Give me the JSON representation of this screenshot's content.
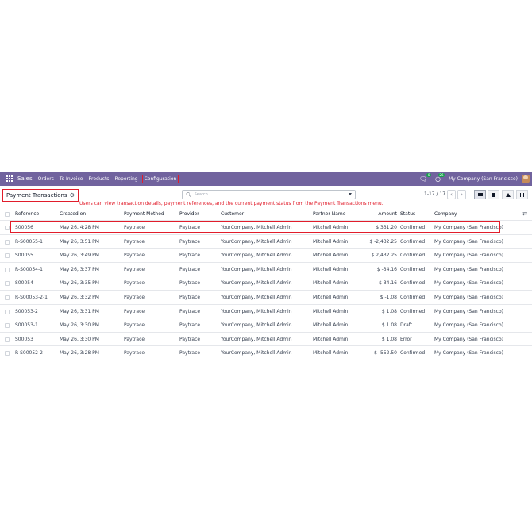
{
  "navbar": {
    "app_name": "Sales",
    "menu": [
      "Orders",
      "To Invoice",
      "Products",
      "Reporting",
      "Configuration"
    ],
    "active_menu": "Configuration",
    "messages_count": "8",
    "activities_count": "26",
    "company": "My Company (San Francisco)"
  },
  "control_panel": {
    "title": "Payment Transactions",
    "annotation": "Users can view transaction details, payment references, and the current payment status from the Payment Transactions menu.",
    "search_placeholder": "Search...",
    "pager": "1-17 / 17"
  },
  "table": {
    "columns": {
      "reference": "Reference",
      "created_on": "Created on",
      "payment_method": "Payment Method",
      "provider": "Provider",
      "customer": "Customer",
      "partner_name": "Partner Name",
      "amount": "Amount",
      "status": "Status",
      "company": "Company"
    },
    "rows": [
      {
        "reference": "S00056",
        "created_on": "May 26, 4:28 PM",
        "payment_method": "Paytrace",
        "provider": "Paytrace",
        "customer": "YourCompany, Mitchell Admin",
        "partner_name": "Mitchell Admin",
        "amount": "$ 331.20",
        "status": "Confirmed",
        "company": "My Company (San Francisco)"
      },
      {
        "reference": "R-S00055-1",
        "created_on": "May 26, 3:51 PM",
        "payment_method": "Paytrace",
        "provider": "Paytrace",
        "customer": "YourCompany, Mitchell Admin",
        "partner_name": "Mitchell Admin",
        "amount": "$ -2,432.25",
        "status": "Confirmed",
        "company": "My Company (San Francisco)"
      },
      {
        "reference": "S00055",
        "created_on": "May 26, 3:49 PM",
        "payment_method": "Paytrace",
        "provider": "Paytrace",
        "customer": "YourCompany, Mitchell Admin",
        "partner_name": "Mitchell Admin",
        "amount": "$ 2,432.25",
        "status": "Confirmed",
        "company": "My Company (San Francisco)"
      },
      {
        "reference": "R-S00054-1",
        "created_on": "May 26, 3:37 PM",
        "payment_method": "Paytrace",
        "provider": "Paytrace",
        "customer": "YourCompany, Mitchell Admin",
        "partner_name": "Mitchell Admin",
        "amount": "$ -34.16",
        "status": "Confirmed",
        "company": "My Company (San Francisco)"
      },
      {
        "reference": "S00054",
        "created_on": "May 26, 3:35 PM",
        "payment_method": "Paytrace",
        "provider": "Paytrace",
        "customer": "YourCompany, Mitchell Admin",
        "partner_name": "Mitchell Admin",
        "amount": "$ 34.16",
        "status": "Confirmed",
        "company": "My Company (San Francisco)"
      },
      {
        "reference": "R-S00053-2-1",
        "created_on": "May 26, 3:32 PM",
        "payment_method": "Paytrace",
        "provider": "Paytrace",
        "customer": "YourCompany, Mitchell Admin",
        "partner_name": "Mitchell Admin",
        "amount": "$ -1.08",
        "status": "Confirmed",
        "company": "My Company (San Francisco)"
      },
      {
        "reference": "S00053-2",
        "created_on": "May 26, 3:31 PM",
        "payment_method": "Paytrace",
        "provider": "Paytrace",
        "customer": "YourCompany, Mitchell Admin",
        "partner_name": "Mitchell Admin",
        "amount": "$ 1.08",
        "status": "Confirmed",
        "company": "My Company (San Francisco)"
      },
      {
        "reference": "S00053-1",
        "created_on": "May 26, 3:30 PM",
        "payment_method": "Paytrace",
        "provider": "Paytrace",
        "customer": "YourCompany, Mitchell Admin",
        "partner_name": "Mitchell Admin",
        "amount": "$ 1.08",
        "status": "Draft",
        "company": "My Company (San Francisco)"
      },
      {
        "reference": "S00053",
        "created_on": "May 26, 3:30 PM",
        "payment_method": "Paytrace",
        "provider": "Paytrace",
        "customer": "YourCompany, Mitchell Admin",
        "partner_name": "Mitchell Admin",
        "amount": "$ 1.08",
        "status": "Error",
        "company": "My Company (San Francisco)"
      },
      {
        "reference": "R-S00052-2",
        "created_on": "May 26, 3:28 PM",
        "payment_method": "Paytrace",
        "provider": "Paytrace",
        "customer": "YourCompany, Mitchell Admin",
        "partner_name": "Mitchell Admin",
        "amount": "$ -552.50",
        "status": "Confirmed",
        "company": "My Company (San Francisco)"
      }
    ]
  },
  "colors": {
    "navbar": "#71639e",
    "highlight": "#e11d2b"
  }
}
